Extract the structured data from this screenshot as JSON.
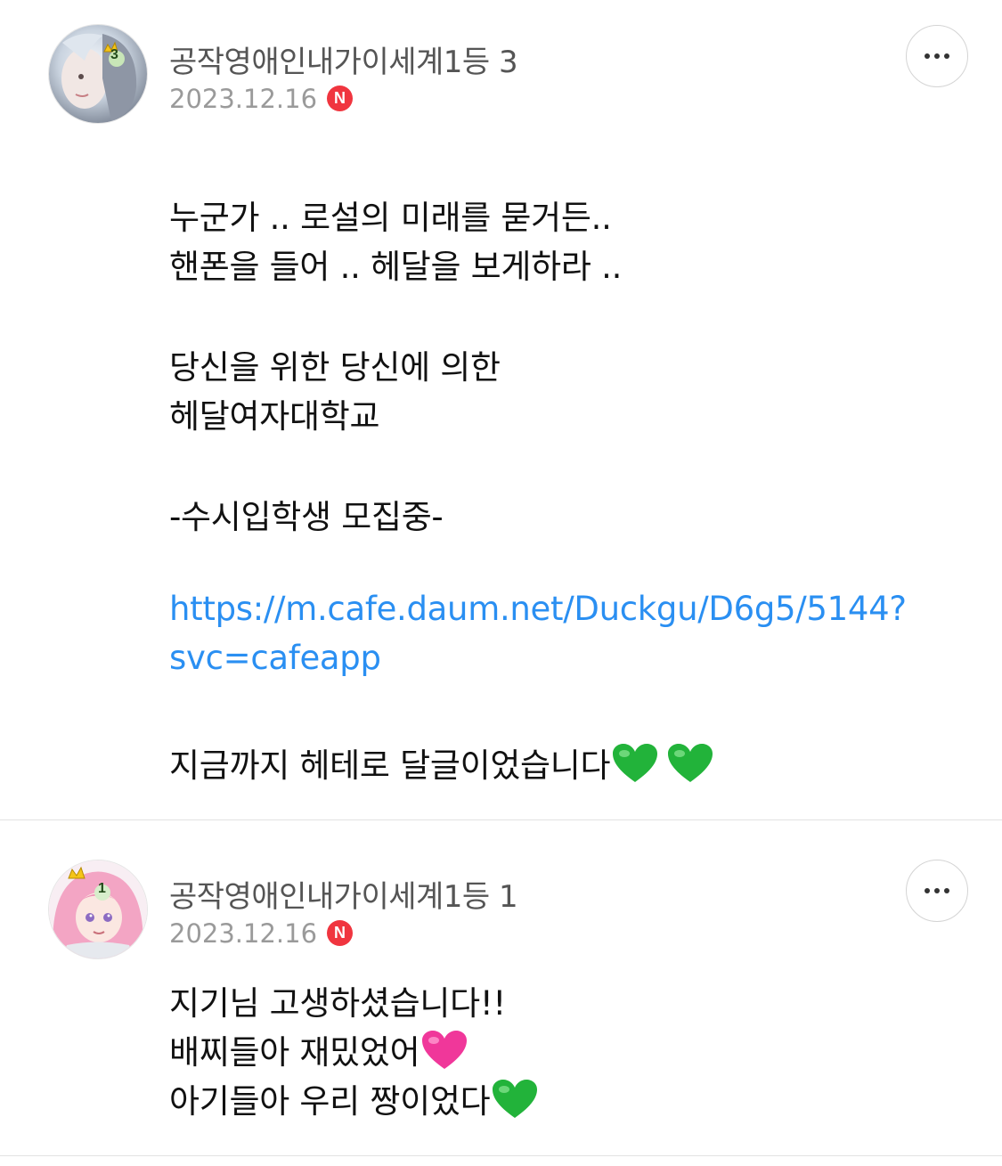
{
  "comments": [
    {
      "author": "공작영애인내가이세계1등 3",
      "date": "2023.12.16",
      "new_badge": "N",
      "level_badge": "3",
      "lines": {
        "l1": "누군가 .. 로설의 미래를 묻거든..",
        "l2": "핸폰을 들어 .. 헤달을 보게하라 ..",
        "l3": "당신을 위한 당신에 의한",
        "l4": "헤달여자대학교",
        "l5": "-수시입학생 모집중-",
        "link1": "https://m.cafe.daum.net/Duckgu/D6g5/5144?",
        "link2": "svc=cafeapp",
        "l6": "지금까지 헤테로 달글이었습니다"
      },
      "emoji": [
        "green-heart",
        "green-heart"
      ]
    },
    {
      "author": "공작영애인내가이세계1등 1",
      "date": "2023.12.16",
      "new_badge": "N",
      "level_badge": "1",
      "lines": {
        "l1": "지기님 고생하셨습니다!!",
        "l2": "배찌들아 재밌었어",
        "l3": "아기들아 우리 짱이었다"
      },
      "emoji": [
        "pink-heart",
        "green-heart"
      ]
    }
  ],
  "colors": {
    "link": "#2a8ff2",
    "new_badge": "#f0353f",
    "green_heart": "#22b33a",
    "pink_heart": "#f0379a"
  }
}
